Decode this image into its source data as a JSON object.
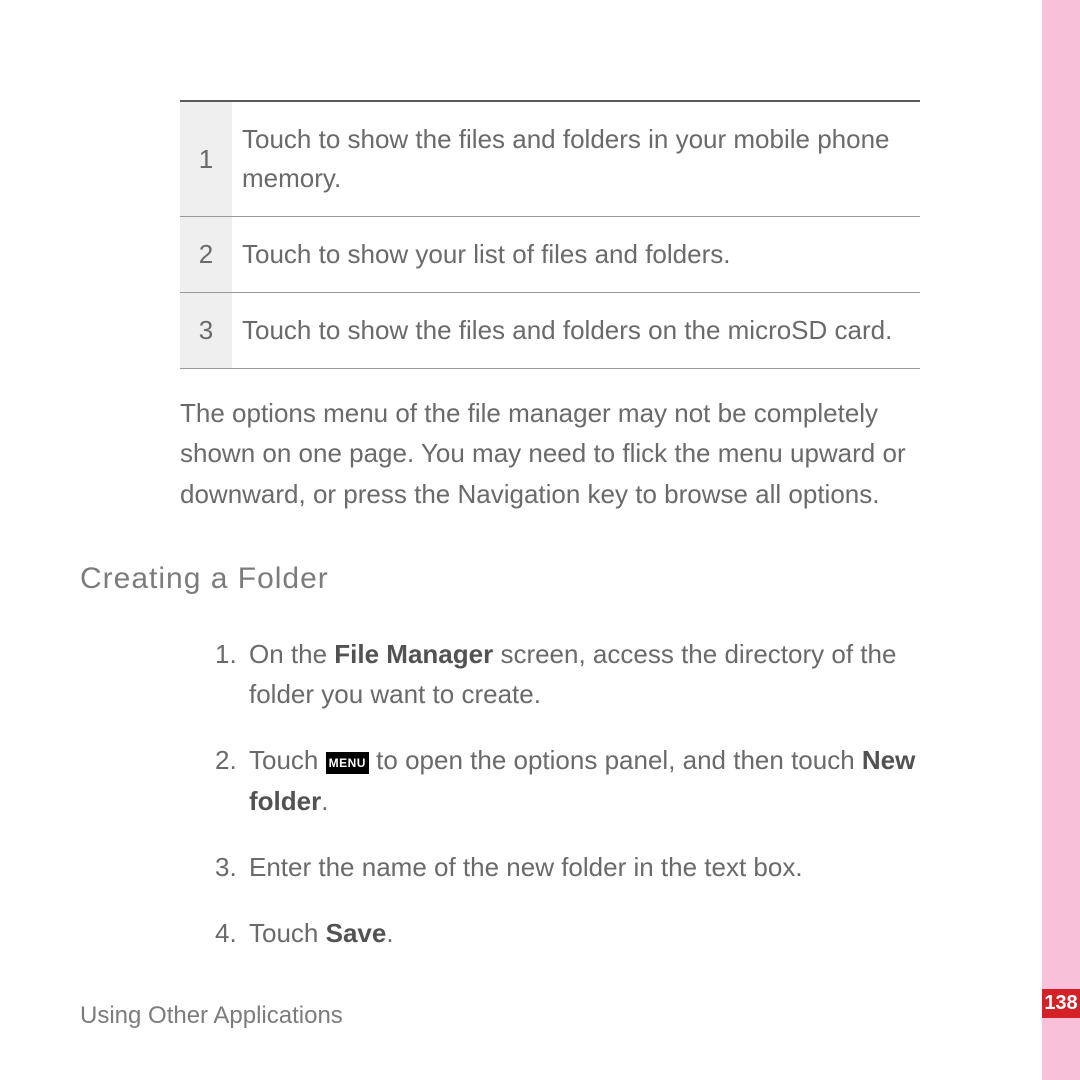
{
  "table": {
    "rows": [
      {
        "num": "1",
        "text": "Touch to show the files and folders in your mobile phone memory."
      },
      {
        "num": "2",
        "text": "Touch to show your list of files and folders."
      },
      {
        "num": "3",
        "text": "Touch to show the files and folders on the microSD card."
      }
    ]
  },
  "note_text": "The options menu of the file manager may not be completely shown on one page. You may need to flick the menu upward or downward, or press the Navigation key to browse all options.",
  "section_heading": "Creating a Folder",
  "steps": {
    "s1_pre": "On the ",
    "s1_bold": "File Manager",
    "s1_post": " screen, access the directory of the folder you want to create.",
    "s2_pre": "Touch ",
    "s2_menu_label": "MENU",
    "s2_mid": " to open the options panel, and then touch ",
    "s2_bold": "New folder",
    "s2_post": ".",
    "s3": "Enter the name of the new folder in the text box.",
    "s4_pre": "Touch ",
    "s4_bold": "Save",
    "s4_post": "."
  },
  "footer": "Using Other Applications",
  "page_number": "138"
}
